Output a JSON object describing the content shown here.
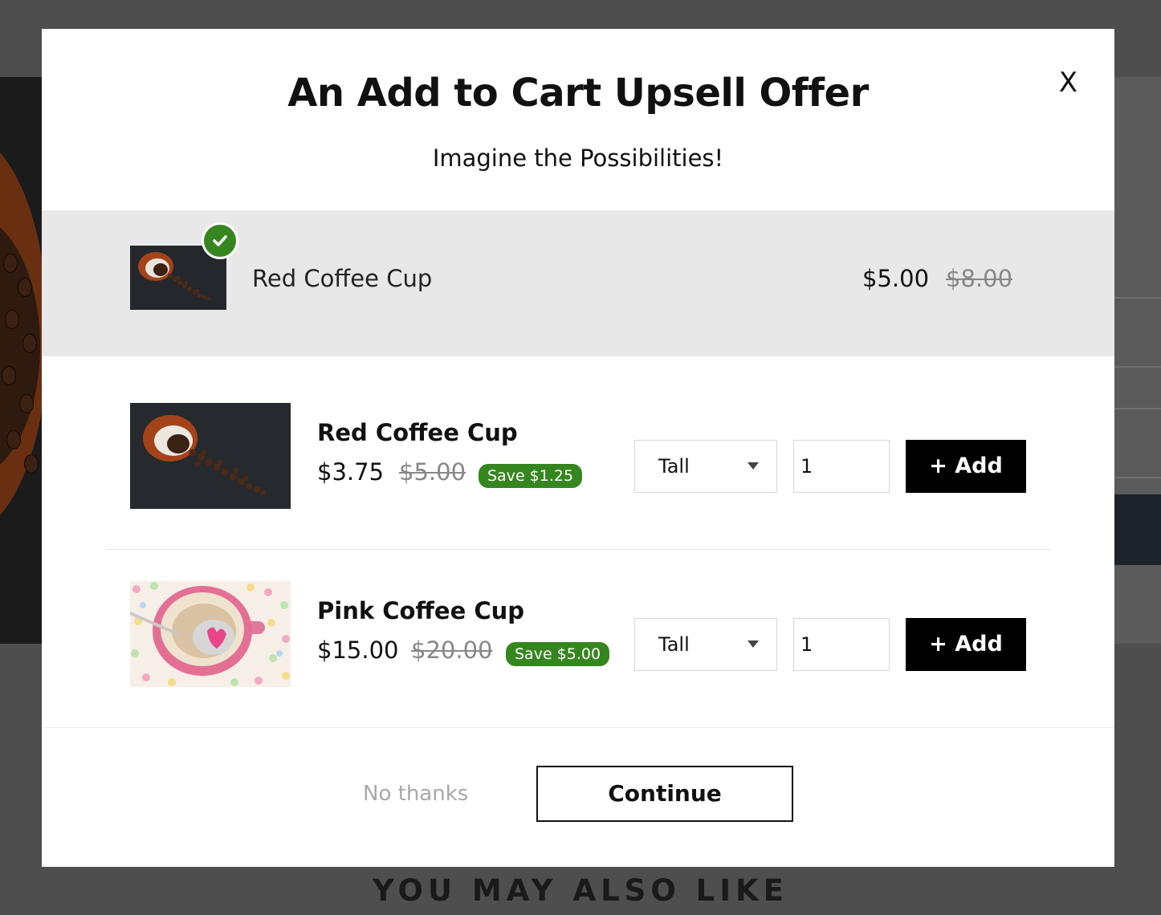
{
  "background": {
    "section_heading": "YOU MAY ALSO LIKE"
  },
  "modal": {
    "title": "An Add to Cart Upsell Offer",
    "subtitle": "Imagine the Possibilities!",
    "close_label": "X",
    "added_item": {
      "name": "Red Coffee Cup",
      "price": "$5.00",
      "original_price": "$8.00",
      "status_icon": "check-icon",
      "status_color": "#36861f"
    },
    "offers": [
      {
        "name": "Red Coffee Cup",
        "price": "$3.75",
        "original_price": "$5.00",
        "savings": "Save $1.25",
        "size": "Tall",
        "quantity": "1",
        "add_label": "+ Add"
      },
      {
        "name": "Pink Coffee Cup",
        "price": "$15.00",
        "original_price": "$20.00",
        "savings": "Save $5.00",
        "size": "Tall",
        "quantity": "1",
        "add_label": "+ Add"
      }
    ],
    "footer": {
      "decline_label": "No thanks",
      "continue_label": "Continue"
    }
  },
  "colors": {
    "accent_green": "#36861f",
    "button_black": "#000000",
    "overlay": "#4e4e4e"
  }
}
